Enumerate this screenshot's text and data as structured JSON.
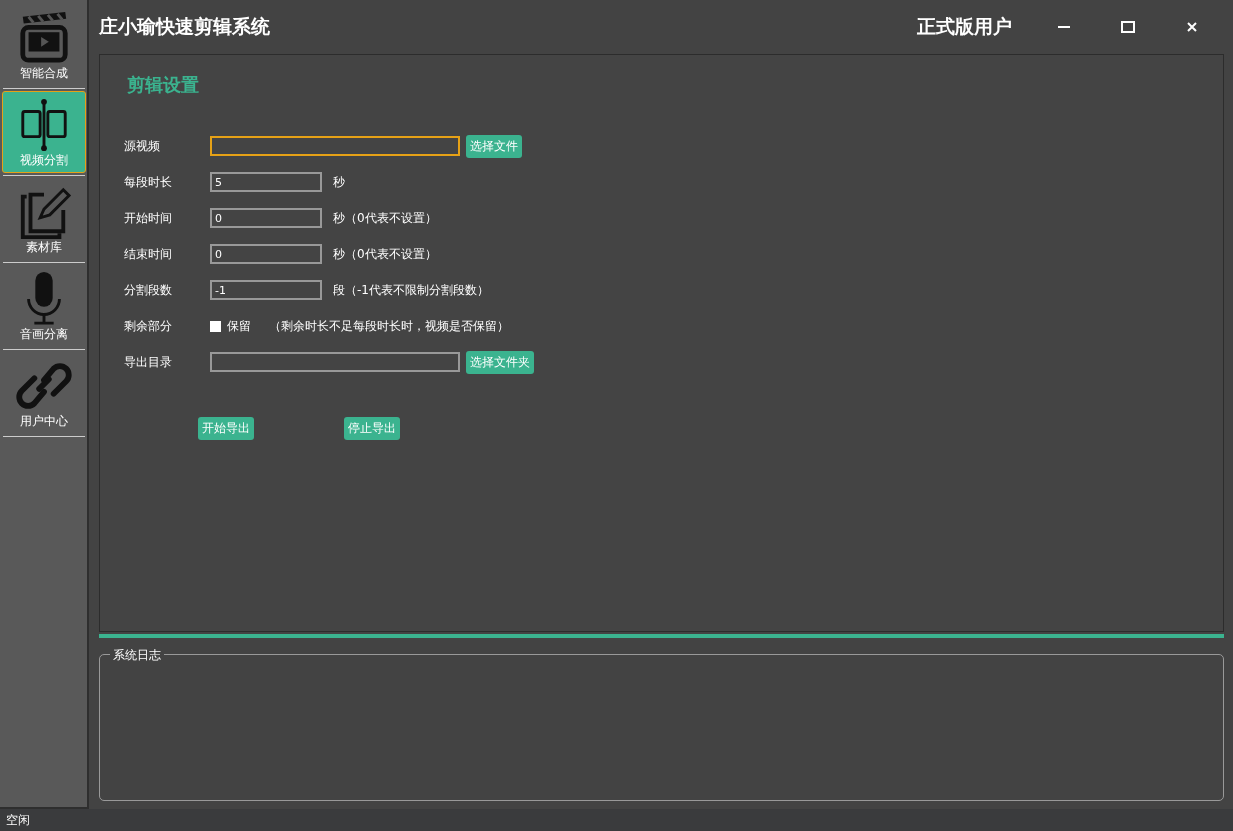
{
  "window": {
    "title": "庄小瑜快速剪辑系统",
    "user_label": "正式版用户"
  },
  "sidebar": {
    "items": [
      {
        "kind": "clapper",
        "label": "智能合成",
        "selected": false
      },
      {
        "kind": "split",
        "label": "视频分割",
        "selected": true
      },
      {
        "kind": "edit",
        "label": "素材库",
        "selected": false
      },
      {
        "kind": "mic",
        "label": "音画分离",
        "selected": false
      },
      {
        "kind": "link",
        "label": "用户中心",
        "selected": false
      }
    ]
  },
  "panel": {
    "heading": "剪辑设置",
    "rows": [
      {
        "kind": "file",
        "label": "源视频",
        "value": "",
        "focused": true,
        "button": "选择文件"
      },
      {
        "kind": "number",
        "label": "每段时长",
        "value": "5",
        "unit": "秒"
      },
      {
        "kind": "number",
        "label": "开始时间",
        "value": "0",
        "unit": "秒（0代表不设置）"
      },
      {
        "kind": "number",
        "label": "结束时间",
        "value": "0",
        "unit": "秒（0代表不设置）"
      },
      {
        "kind": "number",
        "label": "分割段数",
        "value": "-1",
        "unit": "段（-1代表不限制分割段数）"
      },
      {
        "kind": "checkbox",
        "label": "剩余部分",
        "checked": false,
        "option": "保留",
        "note": "（剩余时长不足每段时长时，视频是否保留）"
      },
      {
        "kind": "file",
        "label": "导出目录",
        "value": "",
        "focused": false,
        "button": "选择文件夹"
      }
    ],
    "actions": [
      "开始导出",
      "停止导出"
    ]
  },
  "log": {
    "title": "系统日志"
  },
  "status_bar": {
    "text": "空闲"
  }
}
